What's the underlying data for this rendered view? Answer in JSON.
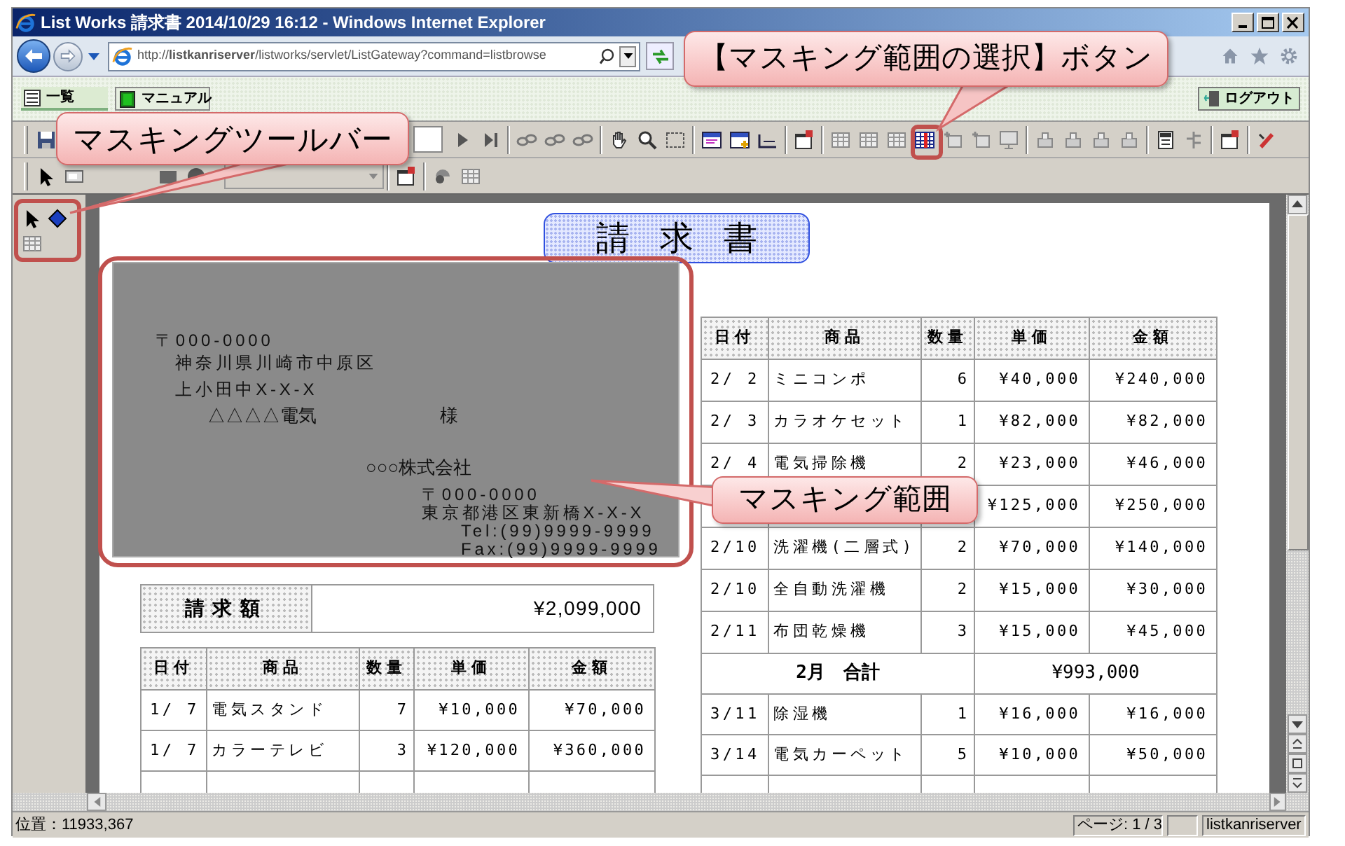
{
  "window": {
    "title": "List Works 請求書 2014/10/29 16:12 - Windows Internet Explorer"
  },
  "address_bar": {
    "url": "http://**listkanriserver**/listworks/servlet/ListGateway?command=listbrowse"
  },
  "nav_buttons": [
    {
      "label": "一覧"
    },
    {
      "label": "マニュアル"
    }
  ],
  "logout_button": {
    "label": "ログアウト"
  },
  "report": {
    "title": "請求書",
    "masked_area": {
      "recipient_postal": "〒000-0000",
      "recipient_address": [
        "神奈川県川崎市中原区",
        "上小田中X-X-X"
      ],
      "recipient_name": "△△△△電気",
      "honorific": "様",
      "sender_name": "○○○株式会社",
      "sender_postal": "〒000-0000",
      "sender_address": "東京都港区東新橋X-X-X",
      "sender_tel": "Tel:(99)9999-9999",
      "sender_fax": "Fax:(99)9999-9999"
    },
    "billing": {
      "label": "請求額",
      "amount": "¥2,099,000"
    },
    "left_table": {
      "columns": [
        "日付",
        "商品",
        "数量",
        "単価",
        "金額"
      ],
      "rows": [
        {
          "date": "1/ 7",
          "product": "電気スタンド",
          "qty": "7",
          "unit_price": "¥10,000",
          "amount": "¥70,000"
        },
        {
          "date": "1/ 7",
          "product": "カラーテレビ",
          "qty": "3",
          "unit_price": "¥120,000",
          "amount": "¥360,000"
        }
      ]
    },
    "right_table": {
      "columns": [
        "日付",
        "商品",
        "数量",
        "単価",
        "金額"
      ],
      "rows": [
        {
          "kind": "item",
          "date": "2/ 2",
          "product": "ミニコンポ",
          "qty": "6",
          "unit_price": "¥40,000",
          "amount": "¥240,000"
        },
        {
          "kind": "item",
          "date": "2/ 3",
          "product": "カラオケセット",
          "qty": "1",
          "unit_price": "¥82,000",
          "amount": "¥82,000"
        },
        {
          "kind": "item",
          "date": "2/ 4",
          "product": "電気掃除機",
          "qty": "2",
          "unit_price": "¥23,000",
          "amount": "¥46,000"
        },
        {
          "kind": "item",
          "unit_price": "¥125,000",
          "amount": "¥250,000"
        },
        {
          "kind": "item",
          "date": "2/10",
          "product": "洗濯機(二層式)",
          "qty": "2",
          "unit_price": "¥70,000",
          "amount": "¥140,000"
        },
        {
          "kind": "item",
          "date": "2/10",
          "product": "全自動洗濯機",
          "qty": "2",
          "unit_price": "¥15,000",
          "amount": "¥30,000"
        },
        {
          "kind": "item",
          "date": "2/11",
          "product": "布団乾燥機",
          "qty": "3",
          "unit_price": "¥15,000",
          "amount": "¥45,000"
        },
        {
          "kind": "total",
          "label": "2月　合計",
          "amount": "¥993,000"
        },
        {
          "kind": "item",
          "date": "3/11",
          "product": "除湿機",
          "qty": "1",
          "unit_price": "¥16,000",
          "amount": "¥16,000"
        },
        {
          "kind": "item",
          "date": "3/14",
          "product": "電気カーペット",
          "qty": "5",
          "unit_price": "¥10,000",
          "amount": "¥50,000"
        }
      ]
    }
  },
  "status_bar": {
    "position": "位置：11933,367",
    "page": "ページ: 1 / 3",
    "server": "listkanriserver"
  },
  "callouts": [
    {
      "text": "マスキングツールバー"
    },
    {
      "text": "【マスキング範囲の選択】ボタン"
    },
    {
      "text": "マスキング範囲"
    }
  ]
}
